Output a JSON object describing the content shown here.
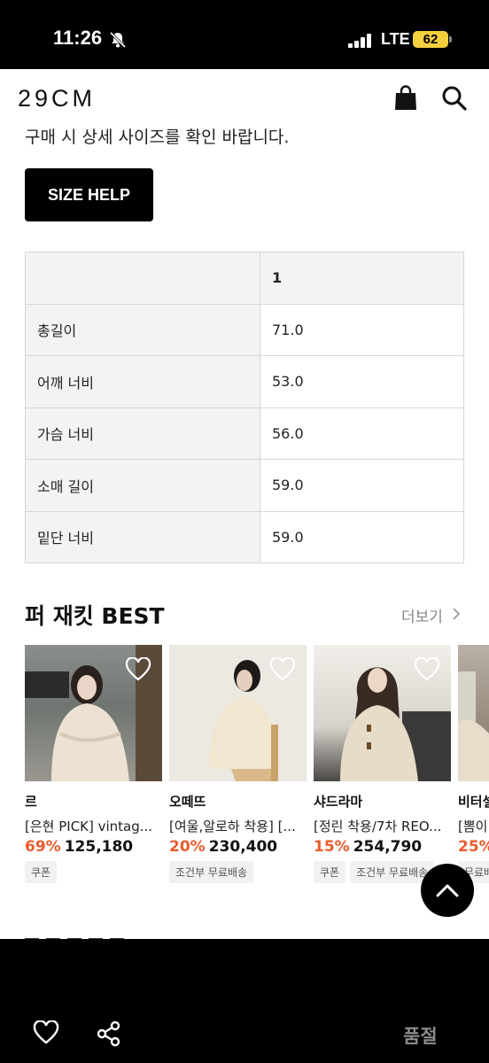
{
  "status_bar": {
    "time": "11:26",
    "network": "LTE",
    "battery": "62"
  },
  "header": {
    "logo": "29CM"
  },
  "size_note": "구매 시 상세 사이즈를 확인 바랍니다.",
  "size_help_label": "SIZE HELP",
  "size_table": {
    "header": [
      "",
      "1"
    ],
    "rows": [
      {
        "label": "총길이",
        "value": "71.0"
      },
      {
        "label": "어깨 너비",
        "value": "53.0"
      },
      {
        "label": "가슴 너비",
        "value": "56.0"
      },
      {
        "label": "소매 길이",
        "value": "59.0"
      },
      {
        "label": "밑단 너비",
        "value": "59.0"
      }
    ]
  },
  "best_section": {
    "title": "퍼 재킷 BEST",
    "more_label": "더보기",
    "products": [
      {
        "brand": "르",
        "name": "[은현 PICK] vintag...",
        "discount": "69%",
        "price": "125,180",
        "badges": [
          "쿠폰"
        ]
      },
      {
        "brand": "오떼뜨",
        "name": "[여울,알로하 착용] [...",
        "discount": "20%",
        "price": "230,400",
        "badges": [
          "조건부 무료배송"
        ]
      },
      {
        "brand": "샤드라마",
        "name": "[정린 착용/7차 REO...",
        "discount": "15%",
        "price": "254,790",
        "badges": [
          "쿠폰",
          "조건부 무료배송"
        ]
      },
      {
        "brand": "비터셀",
        "name": "[뽐이",
        "discount": "25%",
        "price": "",
        "badges": [
          "무료배"
        ]
      }
    ]
  },
  "bottom_bar": {
    "soldout_label": "품절"
  },
  "colors": {
    "accent_discount": "#ea5b2c",
    "status_battery": "#f4d03f"
  }
}
